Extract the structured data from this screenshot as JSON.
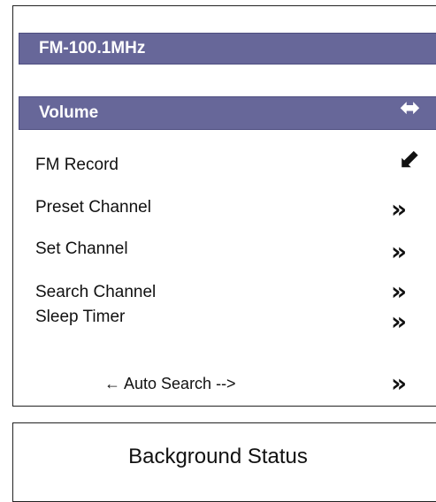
{
  "header": {
    "frequency_label": "FM-100.1MHz"
  },
  "volume": {
    "label": "Volume",
    "icon": "left-right-arrow-icon"
  },
  "menu": {
    "items": [
      {
        "label": "FM Record",
        "icon": "arrow-down-left-icon"
      },
      {
        "label": "Preset Channel",
        "icon": "double-chevron-right-icon"
      },
      {
        "label": "Set Channel",
        "icon": "double-chevron-right-icon"
      },
      {
        "label": "Search Channel",
        "icon": "double-chevron-right-icon"
      },
      {
        "label": "Sleep Timer",
        "icon": "double-chevron-right-icon"
      }
    ],
    "auto_search_label": "← Auto Search -->",
    "auto_search_icon": "double-chevron-right-icon"
  },
  "status": {
    "label": "Background Status"
  },
  "colors": {
    "highlight_bar": "#676799",
    "bar_text": "#ffffff",
    "border": "#222222"
  }
}
